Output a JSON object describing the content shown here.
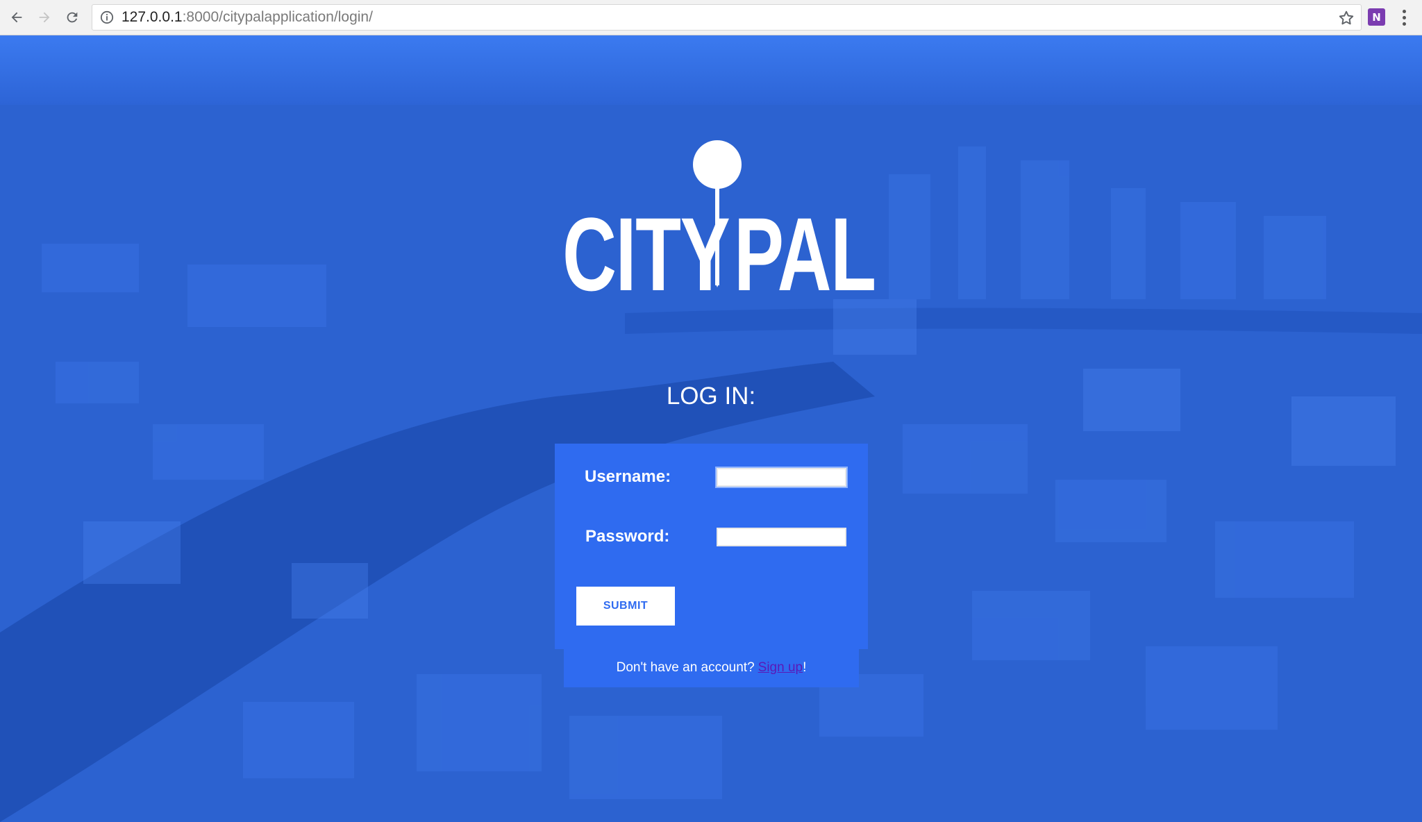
{
  "browser": {
    "url_host": "127.0.0.1",
    "url_rest": ":8000/citypalapplication/login/",
    "extension_label": "N"
  },
  "logo": {
    "left_text": "CITY",
    "right_text": "PAL"
  },
  "login": {
    "heading": "LOG IN:",
    "username_label": "Username:",
    "username_value": "",
    "password_label": "Password:",
    "password_value": "",
    "submit_label": "SUBMIT"
  },
  "signup": {
    "prompt": "Don't have an account?",
    "link_label": "Sign up",
    "suffix": "!"
  },
  "colors": {
    "page_blue": "#2c63d3",
    "form_blue": "#2f6bf0",
    "link_purple": "#5a19b8"
  }
}
